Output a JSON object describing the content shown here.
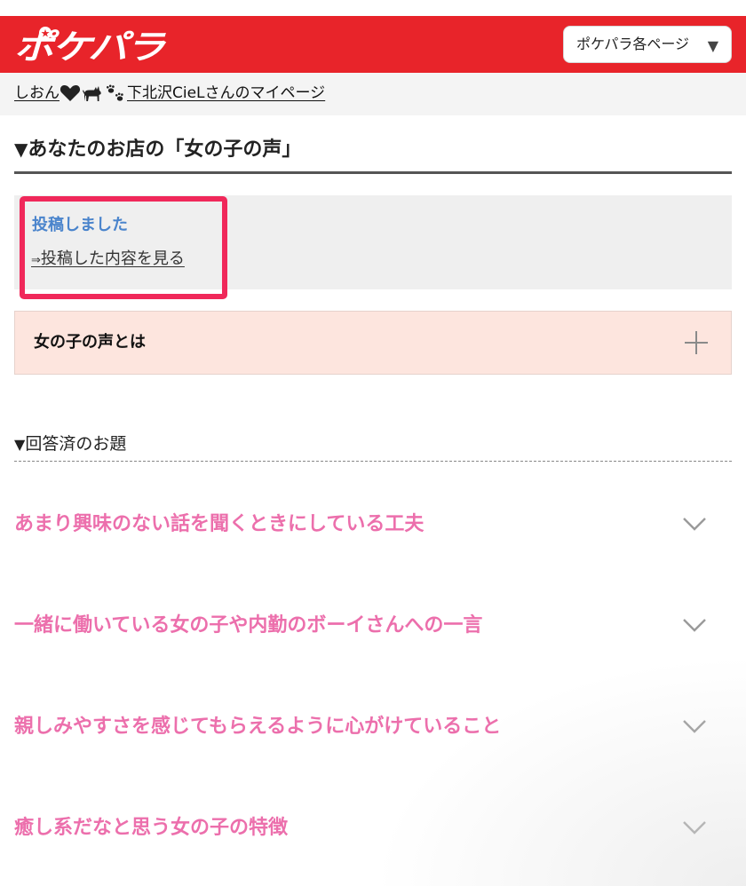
{
  "header": {
    "logo_text": "ポケパラ",
    "pages_button_label": "ポケパラ各ページ",
    "pages_button_caret": "▼",
    "brand_color": "#e8242a"
  },
  "mypage": {
    "name_before": "しおん",
    "name_after": "下北沢CieLさんのマイページ"
  },
  "section": {
    "title_marker": "▼",
    "title": "あなたのお店の「女の子の声」"
  },
  "post_result": {
    "status": "投稿しました",
    "link_arrow": "⇒",
    "link_text": "投稿した内容を見る",
    "status_color": "#4a84cc",
    "highlight_color": "#f0285a"
  },
  "about": {
    "label": "女の子の声とは",
    "expand_icon": "plus-icon"
  },
  "answered": {
    "title_marker": "▼",
    "title": "回答済のお題",
    "topic_color": "#ec6fac",
    "topics": [
      {
        "label": "あまり興味のない話を聞くときにしている工夫"
      },
      {
        "label": "一緒に働いている女の子や内勤のボーイさんへの一言"
      },
      {
        "label": "親しみやすさを感じてもらえるように心がけていること"
      },
      {
        "label": "癒し系だなと思う女の子の特徴"
      }
    ]
  }
}
